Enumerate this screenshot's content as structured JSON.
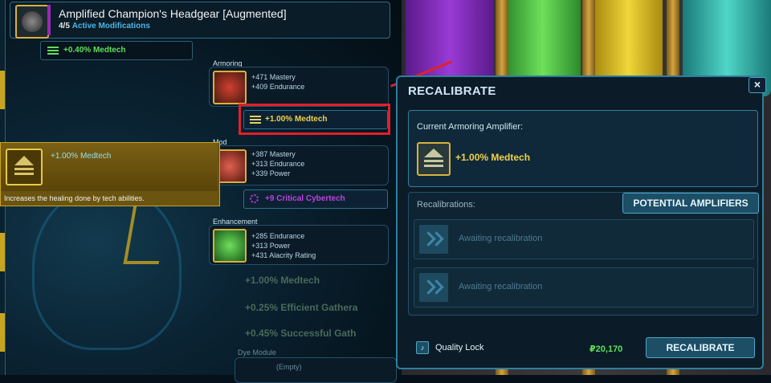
{
  "item": {
    "title": "Amplified Champion's Headgear [Augmented]",
    "mods_count": "4/5",
    "mods_label": "Active Modifications",
    "augment_amplifier": "+0.40% Medtech"
  },
  "slots": {
    "armoring": {
      "label": "Armoring",
      "stats": [
        "+471 Mastery",
        "+409 Endurance"
      ],
      "amplifier": "+1.00% Medtech"
    },
    "mod": {
      "label": "Mod",
      "stats": [
        "+387 Mastery",
        "+313 Endurance",
        "+339 Power"
      ],
      "amplifier": "+9 Critical Cybertech"
    },
    "enhancement": {
      "label": "Enhancement",
      "stats": [
        "+285 Endurance",
        "+313 Power",
        "+431 Alacrity Rating"
      ]
    },
    "dye": {
      "label": "Dye Module",
      "value": "(Empty)"
    }
  },
  "tooltip": {
    "title": "+1.00% Medtech",
    "description": "Increases the healing done by tech abilities."
  },
  "background_rows": [
    "+1.00% Medtech",
    "+0.25% Efficient Gathera",
    "+0.45% Successful Gath"
  ],
  "panel": {
    "title": "RECALIBRATE",
    "close": "×",
    "current_label": "Current Armoring Amplifier:",
    "current_value": "+1.00% Medtech",
    "recalibrations_label": "Recalibrations:",
    "potential_button": "POTENTIAL AMPLIFIERS",
    "awaiting": [
      "Awaiting recalibration",
      "Awaiting recalibration"
    ],
    "quality_lock": "Quality Lock",
    "price": "20,170",
    "recalibrate_button": "RECALIBRATE"
  },
  "colors": {
    "accent_gold": "#d9b040",
    "positive_green": "#5ee05a",
    "amplifier_yellow": "#f2d24a",
    "cybertech_purple": "#c040e0",
    "highlight_red": "#e0202a"
  }
}
